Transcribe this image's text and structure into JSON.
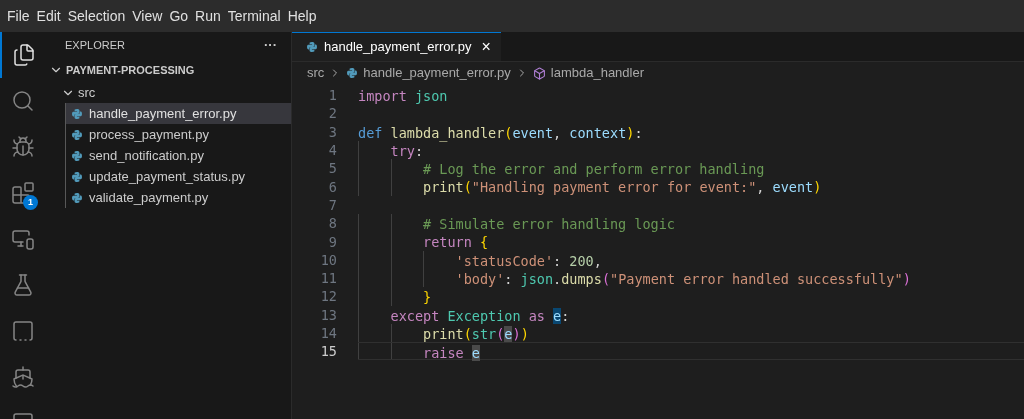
{
  "menu": [
    "File",
    "Edit",
    "Selection",
    "View",
    "Go",
    "Run",
    "Terminal",
    "Help"
  ],
  "activity_bar": [
    {
      "kind": "files",
      "selected": true
    },
    {
      "kind": "search",
      "selected": false
    },
    {
      "kind": "debug",
      "selected": false
    },
    {
      "kind": "extensions",
      "selected": false,
      "badge": "1"
    },
    {
      "kind": "remote",
      "selected": false
    },
    {
      "kind": "testing",
      "selected": false
    },
    {
      "kind": "terraform",
      "selected": false
    },
    {
      "kind": "kubernetes",
      "selected": false
    },
    {
      "kind": "panel",
      "selected": false
    }
  ],
  "explorer": {
    "title": "EXPLORER",
    "more": "···",
    "project": {
      "name": "PAYMENT-PROCESSING",
      "expanded": true,
      "children": [
        {
          "name": "src",
          "expanded": true,
          "children": [
            {
              "name": "handle_payment_error.py",
              "selected": true
            },
            {
              "name": "process_payment.py",
              "selected": false
            },
            {
              "name": "send_notification.py",
              "selected": false
            },
            {
              "name": "update_payment_status.py",
              "selected": false
            },
            {
              "name": "validate_payment.py",
              "selected": false
            }
          ]
        }
      ]
    }
  },
  "tabs": [
    {
      "label": "handle_payment_error.py",
      "selected": true,
      "close": "×"
    }
  ],
  "breadcrumb": {
    "folder": "src",
    "file": "handle_payment_error.py",
    "symbol": "lambda_handler"
  },
  "code": [
    {
      "number": "1",
      "current": false,
      "tokens": [
        {
          "t": "import ",
          "kind": "keyword"
        },
        {
          "t": "json",
          "kind": "class"
        }
      ]
    },
    {
      "number": "2",
      "current": false
    },
    {
      "number": "3",
      "current": false,
      "tokens": [
        {
          "t": "def ",
          "kind": "storage"
        },
        {
          "t": "lambda_handler",
          "kind": "function"
        },
        {
          "t": "(",
          "kind": "bracket"
        },
        {
          "t": "event",
          "kind": "variable"
        },
        {
          "t": ", "
        },
        {
          "t": "context",
          "kind": "variable"
        },
        {
          "t": ")",
          "kind": "bracket"
        },
        {
          "t": ":"
        }
      ]
    },
    {
      "number": "4",
      "current": false,
      "tokens": [
        {
          "t": "    try",
          "kind": "keyword"
        },
        {
          "t": ":"
        }
      ]
    },
    {
      "number": "5",
      "current": false,
      "tokens": [
        {
          "t": "        # Log the error and perform error handling",
          "kind": "comment"
        }
      ]
    },
    {
      "number": "6",
      "current": false,
      "tokens": [
        {
          "t": "        print",
          "kind": "function"
        },
        {
          "t": "(",
          "kind": "bracket"
        },
        {
          "t": "\"Handling payment error for event:\"",
          "kind": "string"
        },
        {
          "t": ", "
        },
        {
          "t": "event",
          "kind": "variable"
        },
        {
          "t": ")",
          "kind": "bracket"
        }
      ]
    },
    {
      "number": "7",
      "current": false
    },
    {
      "number": "8",
      "current": false,
      "tokens": [
        {
          "t": "        # Simulate error handling logic",
          "kind": "comment"
        }
      ]
    },
    {
      "number": "9",
      "current": false,
      "tokens": [
        {
          "t": "        return ",
          "kind": "keyword"
        },
        {
          "t": "{",
          "kind": "bracket"
        }
      ]
    },
    {
      "number": "10",
      "current": false,
      "tokens": [
        {
          "t": "            'statusCode'",
          "kind": "string"
        },
        {
          "t": ": "
        },
        {
          "t": "200",
          "kind": "number"
        },
        {
          "t": ","
        }
      ]
    },
    {
      "number": "11",
      "current": false,
      "tokens": [
        {
          "t": "            'body'",
          "kind": "string"
        },
        {
          "t": ": "
        },
        {
          "t": "json",
          "kind": "class"
        },
        {
          "t": "."
        },
        {
          "t": "dumps",
          "kind": "function"
        },
        {
          "t": "(",
          "kind": "bracket2"
        },
        {
          "t": "\"Payment error handled successfully\"",
          "kind": "string"
        },
        {
          "t": ")",
          "kind": "bracket2"
        }
      ]
    },
    {
      "number": "12",
      "current": false,
      "tokens": [
        {
          "t": "        }",
          "kind": "bracket"
        }
      ]
    },
    {
      "number": "13",
      "current": false,
      "tokens": [
        {
          "t": "    except ",
          "kind": "keyword"
        },
        {
          "t": "Exception ",
          "kind": "class"
        },
        {
          "t": "as ",
          "kind": "keyword"
        },
        {
          "t": "e",
          "kind": "variable",
          "highlighted": true,
          "write_access": true
        },
        {
          "t": ":"
        }
      ]
    },
    {
      "number": "14",
      "current": false,
      "tokens": [
        {
          "t": "        print",
          "kind": "function"
        },
        {
          "t": "(",
          "kind": "bracket"
        },
        {
          "t": "str",
          "kind": "class"
        },
        {
          "t": "(",
          "kind": "bracket2"
        },
        {
          "t": "e",
          "kind": "variable",
          "highlighted": true,
          "write_access": false
        },
        {
          "t": ")",
          "kind": "bracket2"
        },
        {
          "t": ")",
          "kind": "bracket"
        }
      ]
    },
    {
      "number": "15",
      "current": true,
      "tokens": [
        {
          "t": "        raise ",
          "kind": "keyword"
        },
        {
          "t": "e",
          "kind": "variable",
          "highlighted": true,
          "write_access": false
        }
      ]
    }
  ]
}
